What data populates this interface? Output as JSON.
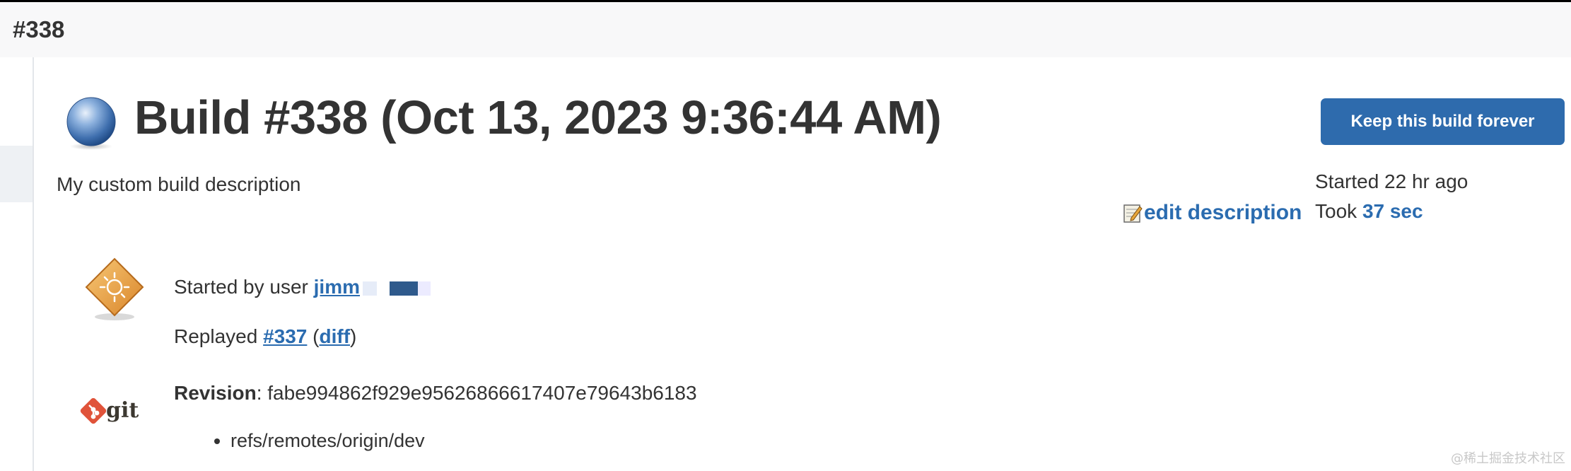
{
  "header": {
    "breadcrumb": "#338"
  },
  "build": {
    "title": "Build #338 (Oct 13, 2023 9:36:44 AM)",
    "status_icon": "blue-ball-icon",
    "description": "My custom build description",
    "edit_description_label": "edit description",
    "keep_forever_label": "Keep this build forever",
    "started": "Started 22 hr ago",
    "took_prefix": "Took ",
    "duration": "37 sec"
  },
  "causes": {
    "started_by_prefix": "Started by user ",
    "user": "jimm",
    "replayed_prefix": "Replayed ",
    "replayed_build": "#337",
    "diff_label": "diff"
  },
  "scm": {
    "logo": "git",
    "revision_label": "Revision",
    "revision_hash": "fabe994862f929e95626866617407e79643b6183",
    "branches": [
      "refs/remotes/origin/dev"
    ]
  },
  "watermark": "@稀土掘金技术社区",
  "colors": {
    "accent": "#2e6bad",
    "link": "#2b6cb0",
    "text": "#333333",
    "topbar_bg": "#f8f8f9"
  }
}
